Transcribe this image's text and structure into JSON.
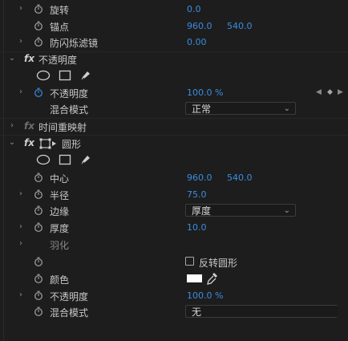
{
  "rows": {
    "rotation": {
      "label": "旋转",
      "value": "0.0"
    },
    "anchor": {
      "label": "锚点",
      "x": "960.0",
      "y": "540.0"
    },
    "antiflicker": {
      "label": "防闪烁滤镜",
      "value": "0.00"
    },
    "opacity_effect": {
      "fx": "fx",
      "label": "不透明度"
    },
    "opacity": {
      "label": "不透明度",
      "value": "100.0 %"
    },
    "blend_mode": {
      "label": "混合模式",
      "value": "正常"
    },
    "time_remap": {
      "fx": "fx",
      "label": "时间重映射"
    },
    "circle_effect": {
      "fx": "fx",
      "label": "圆形"
    },
    "center": {
      "label": "中心",
      "x": "960.0",
      "y": "540.0"
    },
    "radius": {
      "label": "半径",
      "value": "75.0"
    },
    "edge": {
      "label": "边缘",
      "value": "厚度"
    },
    "thickness": {
      "label": "厚度",
      "value": "10.0"
    },
    "feather": {
      "label": "羽化"
    },
    "invert": {
      "label": "反转圆形"
    },
    "color": {
      "label": "颜色",
      "swatch": "#ffffff"
    },
    "circle_opacity": {
      "label": "不透明度",
      "value": "100.0 %"
    },
    "circle_blend": {
      "label": "混合模式",
      "value": "无"
    }
  },
  "colors": {
    "value_blue": "#3a8de0",
    "background": "#1d1d1d"
  }
}
